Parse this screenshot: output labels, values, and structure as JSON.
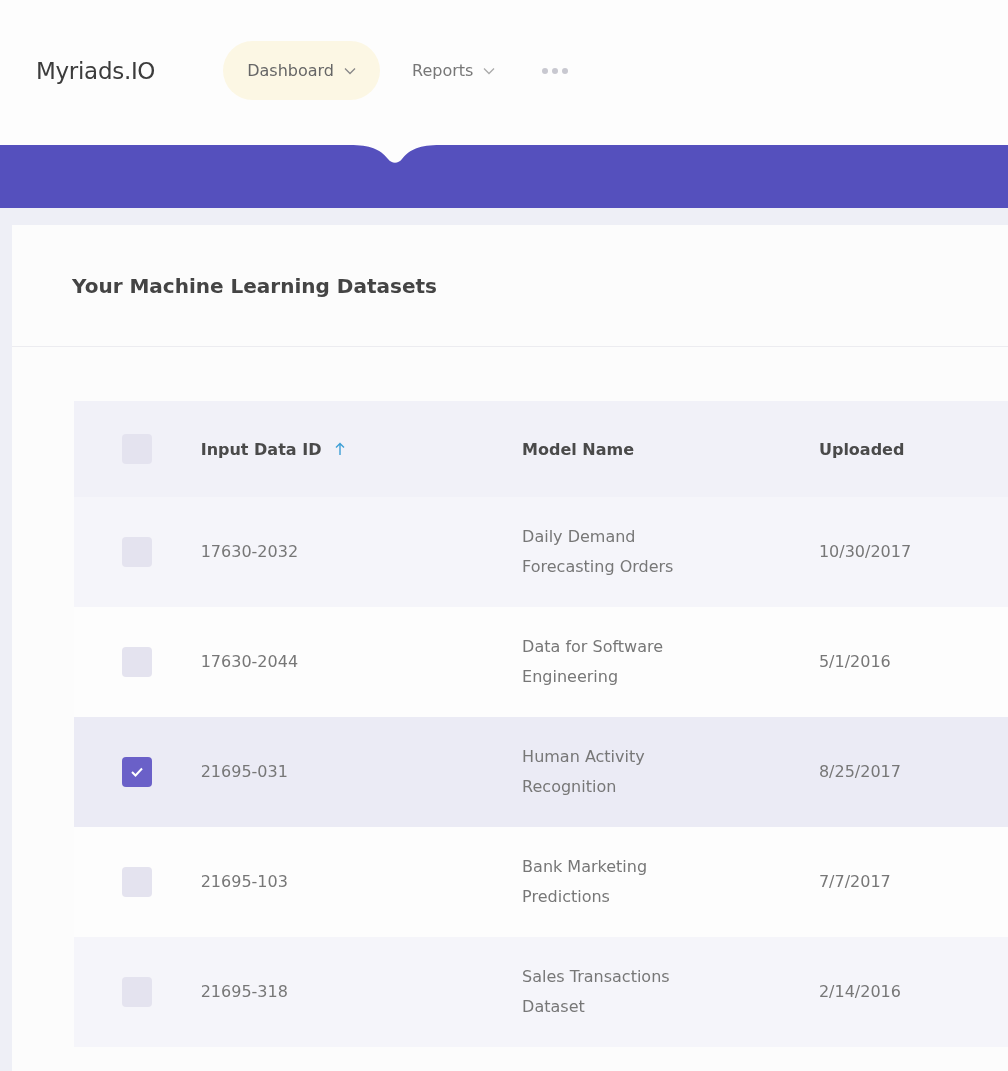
{
  "brand": "Myriads.IO",
  "nav": [
    {
      "label": "Dashboard",
      "selected": true,
      "has_menu": true
    },
    {
      "label": "Reports",
      "selected": false,
      "has_menu": true
    }
  ],
  "card": {
    "title": "Your Machine Learning Datasets"
  },
  "table": {
    "select_all": {
      "checked": false
    },
    "columns": [
      {
        "label": "Input Data ID",
        "sorted": true
      },
      {
        "label": "Model Name",
        "sorted": false
      },
      {
        "label": "Uploaded",
        "sorted": false
      }
    ],
    "rows": [
      {
        "selected": false,
        "cells": [
          "17630-2032",
          "Daily Demand\nForecasting Orders",
          "10/30/2017"
        ]
      },
      {
        "selected": false,
        "cells": [
          "17630-2044",
          "Data for Software\nEngineering",
          "5/1/2016"
        ]
      },
      {
        "selected": true,
        "cells": [
          "21695-031",
          "Human Activity\nRecognition",
          "8/25/2017"
        ]
      },
      {
        "selected": false,
        "cells": [
          "21695-103",
          "Bank Marketing\nPredictions",
          "7/7/2017"
        ]
      },
      {
        "selected": false,
        "cells": [
          "21695-318",
          "Sales Transactions\nDataset",
          "2/14/2016"
        ]
      }
    ]
  }
}
